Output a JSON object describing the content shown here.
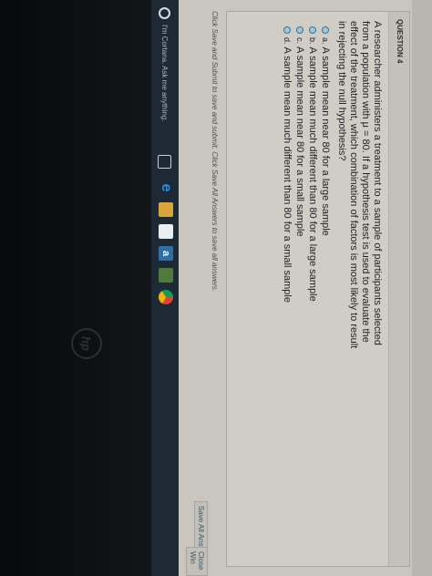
{
  "question": {
    "header": "QUESTION 4",
    "text": "A researcher administers a treatment to a sample of participants selected from a population with μ = 80. If a hypothesis test is used to evaluate the effect of the treatment, which combination of factors is most likely to result in rejecting the null hypothesis?",
    "options": [
      {
        "letter": "a.",
        "text": "A sample mean near 80 for a large sample"
      },
      {
        "letter": "b.",
        "text": "A sample mean much different than 80 for a large sample"
      },
      {
        "letter": "c.",
        "text": "A sample mean near 80 for a small sample"
      },
      {
        "letter": "d.",
        "text": "A sample mean much different than 80 for a small sample"
      }
    ]
  },
  "footer": {
    "note": "Click Save and Submit to save and submit. Click Save All Answers to save all answers.",
    "save_all_label": "Save All Answers",
    "close_label": "Close Win"
  },
  "taskbar": {
    "search_placeholder": "I'm Cortana. Ask me anything.",
    "icons": [
      "task-view",
      "edge",
      "file-explorer",
      "store",
      "amazon",
      "minecraft",
      "chrome"
    ]
  },
  "colors": {
    "page_bg": "#c9c6bf",
    "taskbar_bg": "#1d2a35",
    "radio_fill": "#9ec7e3",
    "link": "#35586e"
  }
}
